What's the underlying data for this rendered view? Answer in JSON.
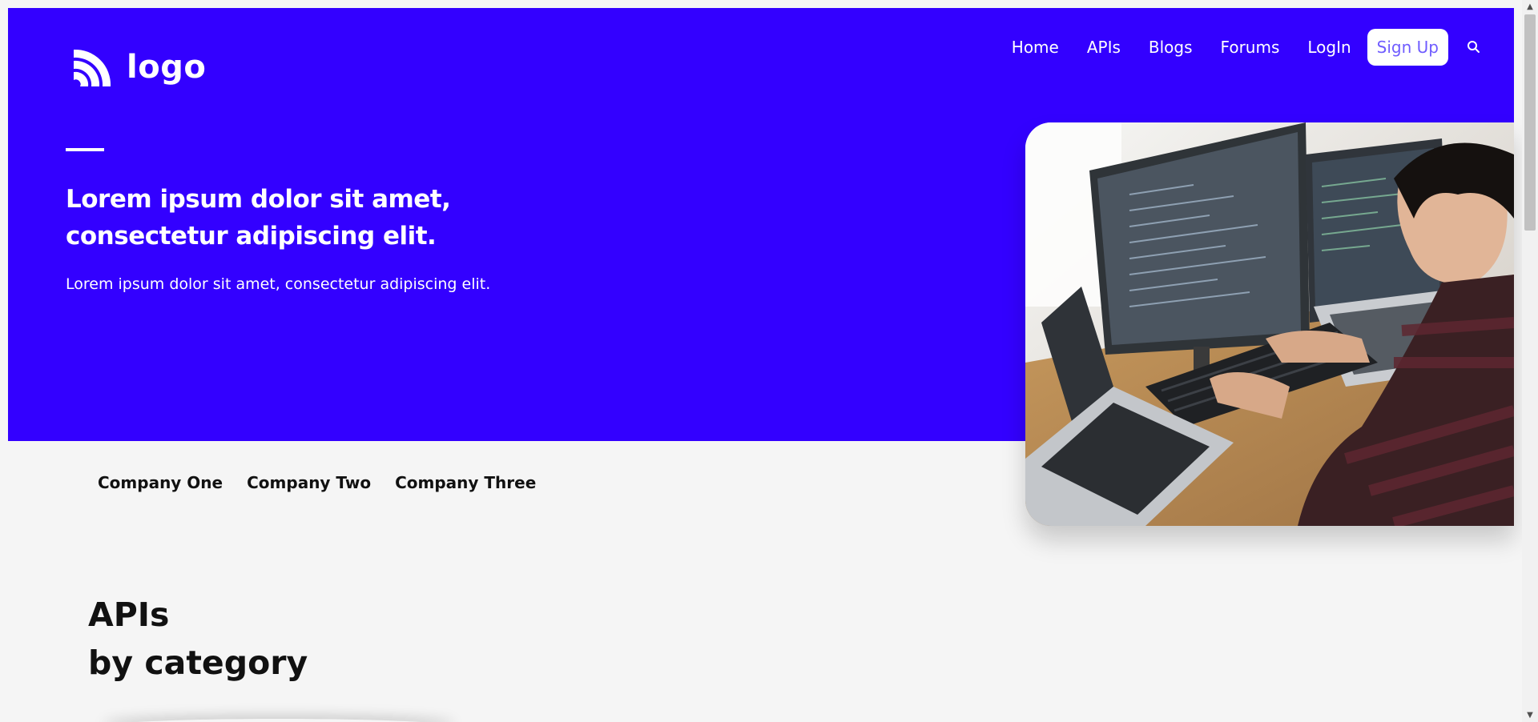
{
  "header": {
    "logo_text": "logo",
    "nav": [
      "Home",
      "APIs",
      "Blogs",
      "Forums",
      "LogIn"
    ],
    "signup_label": "Sign Up"
  },
  "hero": {
    "title": "Lorem ipsum dolor sit amet, consectetur adipiscing elit.",
    "subtitle": "Lorem ipsum dolor sit amet, consectetur adipiscing elit."
  },
  "companies": [
    "Company One",
    "Company Two",
    "Company Three"
  ],
  "section": {
    "title_line1": "APIs",
    "title_line2": "by category"
  },
  "icons": {
    "logo": "rss-arcs-icon",
    "search": "search-icon"
  },
  "colors": {
    "brand": "#3300ff",
    "background": "#f5f5f5",
    "signup_text": "#6f5cff"
  }
}
